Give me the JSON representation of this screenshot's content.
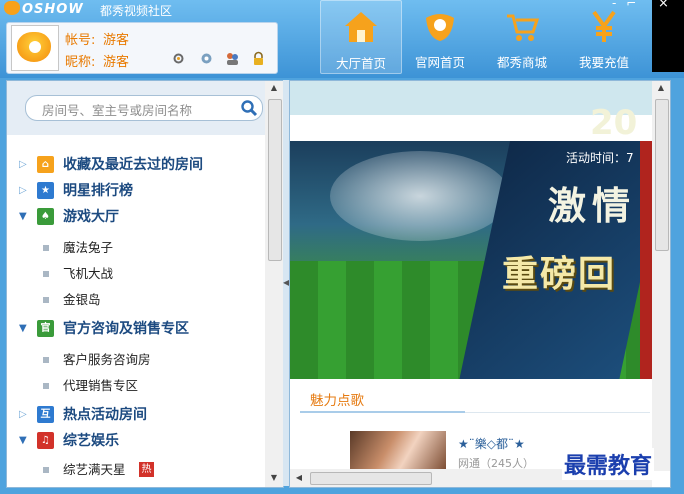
{
  "app": {
    "logo_text": "OSHOW",
    "title": "都秀视频社区"
  },
  "window_controls": {
    "minimize": "-",
    "restore": "⌐",
    "close": "×"
  },
  "user": {
    "account_label": "帐号:",
    "account_value": "游客",
    "nickname_label": "昵称:",
    "nickname_value": "游客"
  },
  "nav": [
    {
      "label": "大厅首页",
      "icon": "home-icon"
    },
    {
      "label": "官网首页",
      "icon": "logo-icon"
    },
    {
      "label": "都秀商城",
      "icon": "cart-icon"
    },
    {
      "label": "我要充值",
      "icon": "yen-icon"
    }
  ],
  "search": {
    "placeholder": "房间号、室主号或房间名称"
  },
  "tree": {
    "fav": {
      "label": "收藏及最近去过的房间",
      "expanded": false
    },
    "star": {
      "label": "明星排行榜",
      "expanded": false
    },
    "games": {
      "label": "游戏大厅",
      "expanded": true,
      "items": [
        "魔法兔子",
        "飞机大战",
        "金银岛"
      ]
    },
    "official": {
      "label": "官方咨询及销售专区",
      "expanded": true,
      "items": [
        "客户服务咨询房",
        "代理销售专区"
      ]
    },
    "hot": {
      "label": "热点活动房间",
      "expanded": false
    },
    "variety": {
      "label": "综艺娱乐",
      "expanded": true,
      "items": [
        "综艺满天星"
      ],
      "badge": "热"
    }
  },
  "banner": {
    "year": "20",
    "time_label": "活动时间：7",
    "headline": "激情",
    "subheadline": "重磅回"
  },
  "section": {
    "tab_label": "魅力点歌"
  },
  "song": {
    "title": "★¨樂◇都¨★",
    "subtitle": "网通（245人）"
  },
  "watermark": "最需教育",
  "colors": {
    "accent_orange": "#e87a00",
    "nav_blue": "#3d93d6",
    "tree_text": "#1c4a80"
  }
}
